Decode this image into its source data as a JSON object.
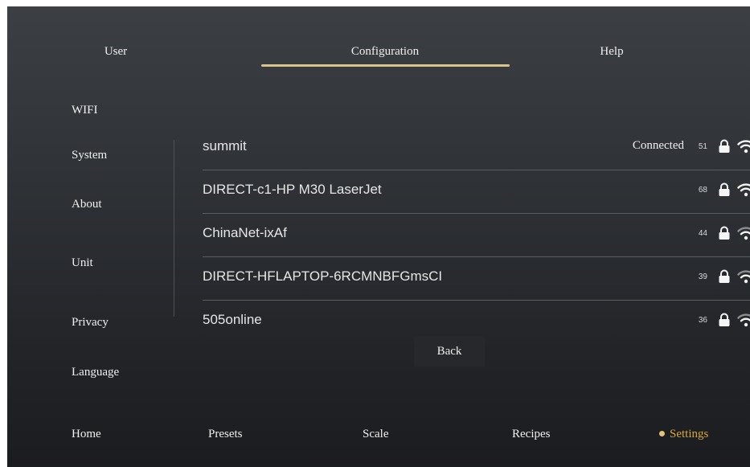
{
  "top_tabs": [
    "User",
    "Configuration",
    "Help"
  ],
  "active_top_tab": "Configuration",
  "side_menu": [
    "WIFI",
    "System",
    "About",
    "Unit",
    "Privacy",
    "Language"
  ],
  "networks": [
    {
      "ssid": "summit",
      "status": "Connected",
      "signal": "51",
      "locked": true,
      "wifi_icon": "wifi-icon"
    },
    {
      "ssid": "DIRECT-c1-HP M30 LaserJet",
      "status": "",
      "signal": "68",
      "locked": true,
      "wifi_icon": "wifi-icon"
    },
    {
      "ssid": "ChinaNet-ixAf",
      "status": "",
      "signal": "44",
      "locked": true,
      "wifi_icon": "wifi-icon"
    },
    {
      "ssid": "DIRECT-HFLAPTOP-6RCMNBFGmsCI",
      "status": "",
      "signal": "39",
      "locked": true,
      "wifi_icon": "wifi-icon"
    },
    {
      "ssid": "505online",
      "status": "",
      "signal": "36",
      "locked": true,
      "wifi_icon": "wifi-icon"
    }
  ],
  "back_label": "Back",
  "bottom_nav": [
    "Home",
    "Presets",
    "Scale",
    "Recipes",
    "Settings"
  ],
  "active_bottom_nav": "Settings",
  "colors": {
    "accent_underline": "#d9c48a",
    "active_nav": "#d6a83a",
    "background": "#2b2e32"
  }
}
